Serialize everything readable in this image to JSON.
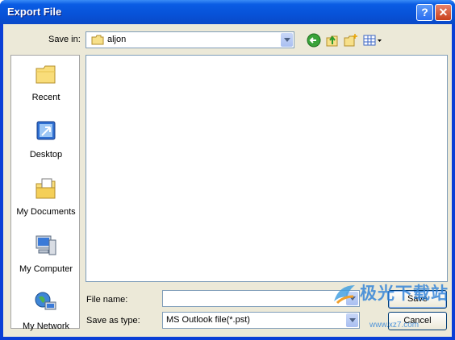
{
  "window": {
    "title": "Export File"
  },
  "titlebar": {
    "help_glyph": "?",
    "close_glyph": "✕"
  },
  "save_in": {
    "label": "Save in:",
    "value": "aljon"
  },
  "toolbar": {
    "icons": [
      "back-icon",
      "up-folder-icon",
      "new-folder-icon",
      "views-menu-icon"
    ]
  },
  "places": [
    {
      "label": "Recent",
      "icon": "recent-folder-icon"
    },
    {
      "label": "Desktop",
      "icon": "desktop-icon"
    },
    {
      "label": "My Documents",
      "icon": "my-documents-icon"
    },
    {
      "label": "My Computer",
      "icon": "my-computer-icon"
    },
    {
      "label": "My Network",
      "icon": "my-network-icon"
    }
  ],
  "form": {
    "file_name_label": "File name:",
    "file_name_value": "",
    "save_as_type_label": "Save as type:",
    "save_as_type_value": "MS Outlook file(*.pst)"
  },
  "buttons": {
    "save": "Save",
    "cancel": "Cancel"
  },
  "watermark": {
    "text": "极光下载站",
    "url": "www.xz7.com"
  },
  "colors": {
    "titlebar": "#0752d8",
    "dialog_bg": "#ece9d8",
    "border": "#7f9db9"
  }
}
